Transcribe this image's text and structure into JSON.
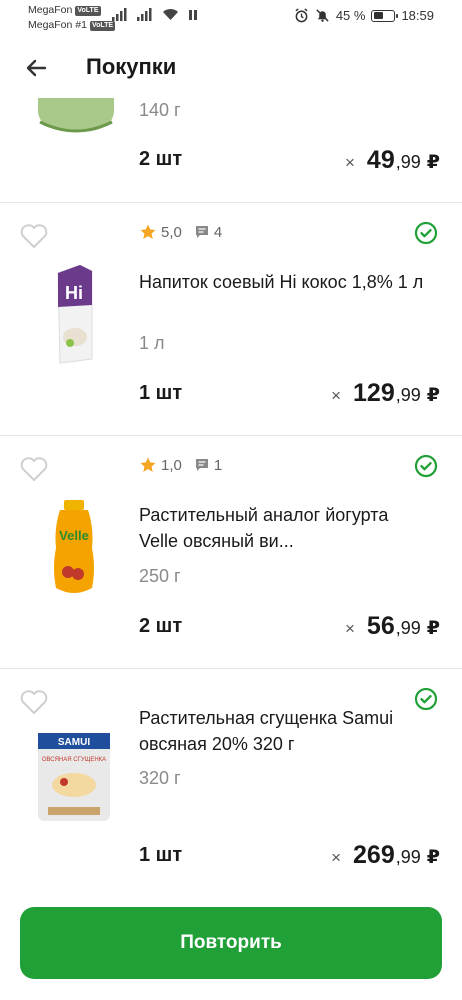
{
  "status_bar": {
    "carrier1": "MegaFon",
    "carrier2": "MegaFon #1",
    "volte": "VoLTE",
    "battery_text": "45 %",
    "battery_level": 0.45,
    "time": "18:59"
  },
  "header": {
    "title": "Покупки"
  },
  "items": [
    {
      "weight": "140 г",
      "qty": "2 шт",
      "times": "×",
      "price_main": "49",
      "price_cents": ",99",
      "currency": "₽"
    },
    {
      "rating": "5,0",
      "reviews": "4",
      "name": "Напиток соевый Hi кокос 1,8% 1 л",
      "weight": "1 л",
      "qty": "1 шт",
      "times": "×",
      "price_main": "129",
      "price_cents": ",99",
      "currency": "₽"
    },
    {
      "rating": "1,0",
      "reviews": "1",
      "name": "Растительный аналог йогурта Velle овсяный ви...",
      "weight": "250 г",
      "qty": "2 шт",
      "times": "×",
      "price_main": "56",
      "price_cents": ",99",
      "currency": "₽"
    },
    {
      "name": "Растительная сгущенка Samui овсяная 20% 320 г",
      "weight": "320 г",
      "qty": "1 шт",
      "times": "×",
      "price_main": "269",
      "price_cents": ",99",
      "currency": "₽",
      "img_brand": "SAMUI",
      "img_label": "ОВСЯНАЯ СГУЩЕНКА"
    }
  ],
  "footer": {
    "repeat_label": "Повторить"
  },
  "colors": {
    "accent": "#21a038",
    "star": "#f5a623",
    "check": "#21a038"
  }
}
